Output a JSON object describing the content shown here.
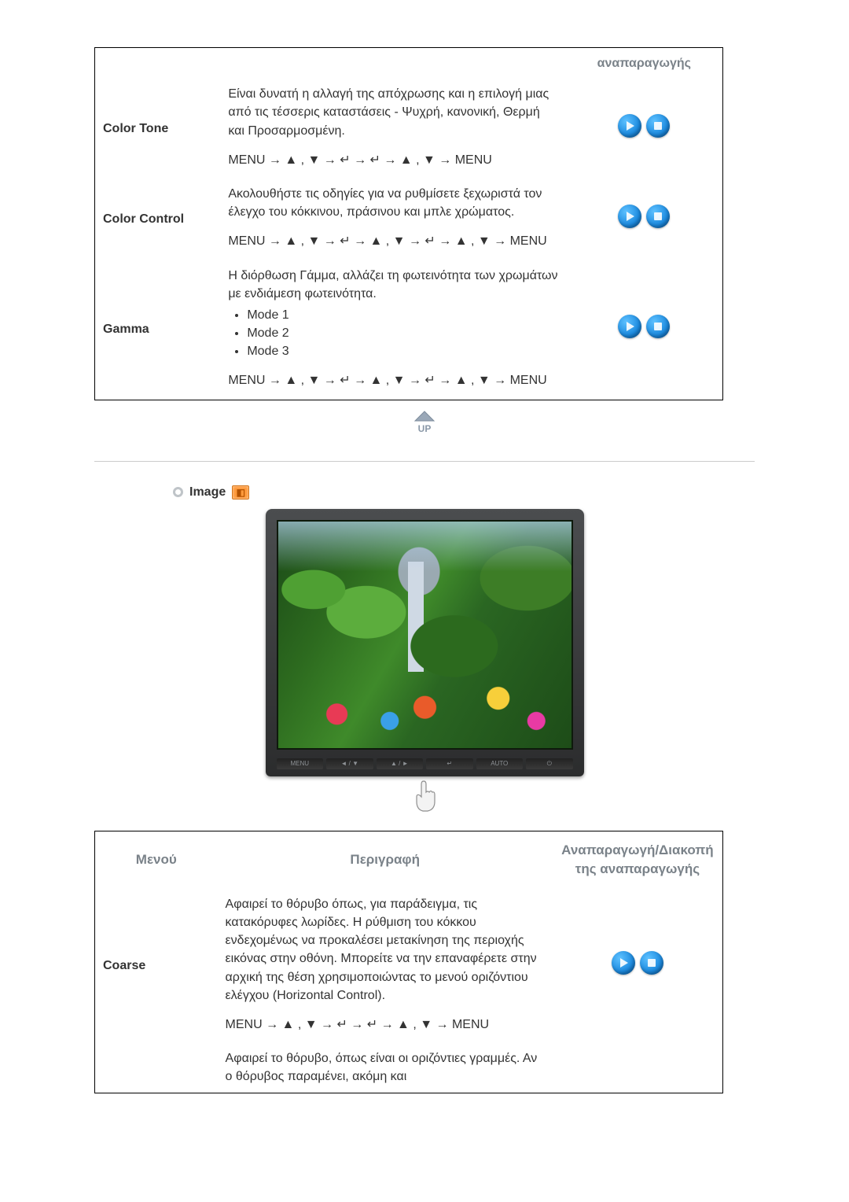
{
  "top": {
    "header_play": "αναπαραγωγής",
    "rows": [
      {
        "name": "Color Tone",
        "desc": "Είναι δυνατή η αλλαγή της απόχρωσης και η επιλογή μιας από τις τέσσερις καταστάσεις - Ψυχρή, κανονική, Θερμή και Προσαρμοσμένη.",
        "seq": "MENU → ▲ , ▼ → ↵ → ↵ → ▲ , ▼ → MENU"
      },
      {
        "name": "Color Control",
        "desc": "Ακολουθήστε τις οδηγίες για να ρυθμίσετε ξεχωριστά τον έλεγχο του κόκκινου, πράσινου και μπλε χρώματος.",
        "seq": "MENU → ▲ , ▼ → ↵ → ▲ , ▼ → ↵ → ▲ , ▼ → MENU"
      },
      {
        "name": "Gamma",
        "desc": "Η διόρθωση Γάμμα, αλλάζει τη φωτεινότητα των χρωμάτων με ενδιάμεση φωτεινότητα.",
        "modes": [
          "Mode 1",
          "Mode 2",
          "Mode 3"
        ],
        "seq": "MENU → ▲ , ▼ → ↵ → ▲ , ▼ → ↵ → ▲ , ▼ → MENU"
      }
    ]
  },
  "image_section": {
    "title": "Image",
    "monitor_buttons": [
      "MENU",
      "◄ / ▼",
      "▲ / ►",
      "↵",
      "AUTO",
      "⏻"
    ]
  },
  "bottom": {
    "headers": {
      "menu": "Μενού",
      "desc": "Περιγραφή",
      "play": "Αναπαραγωγή/Διακοπή της αναπαραγωγής"
    },
    "rows": [
      {
        "name": "Coarse",
        "desc": "Αφαιρεί το θόρυβο όπως, για παράδειγμα, τις κατακόρυφες λωρίδες. Η ρύθμιση του κόκκου ενδεχομένως να προκαλέσει μετακίνηση της περιοχής εικόνας στην οθόνη. Μπορείτε να την επαναφέρετε στην αρχική της θέση χρησιμοποιώντας το μενού οριζόντιου ελέγχου (Horizontal Control).",
        "seq": "MENU → ▲ , ▼ → ↵ → ↵ → ▲ , ▼ → MENU"
      }
    ],
    "trailing": "Αφαιρεί το θόρυβο, όπως είναι οι οριζόντιες γραμμές. Αν ο θόρυβος παραμένει, ακόμη και"
  }
}
